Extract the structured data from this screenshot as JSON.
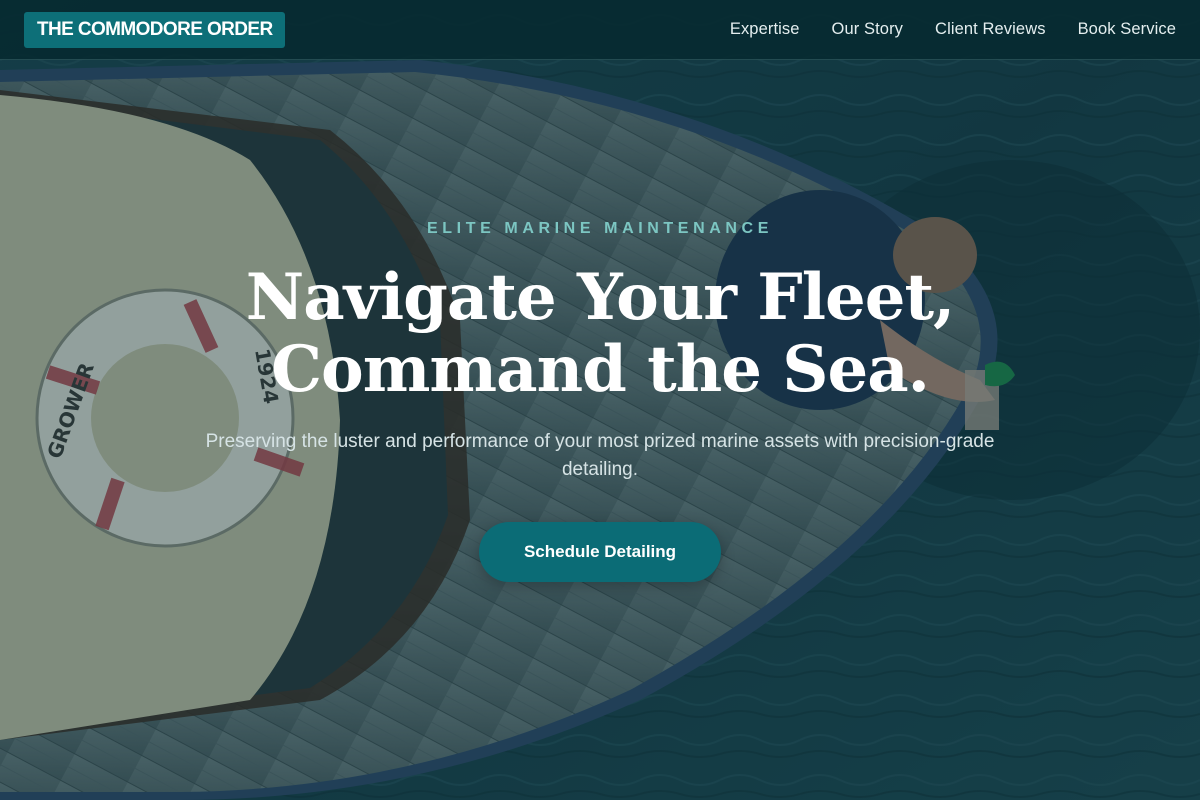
{
  "brand": {
    "name": "THE COMMODORE ORDER"
  },
  "nav": {
    "links": [
      {
        "label": "Expertise"
      },
      {
        "label": "Our Story"
      },
      {
        "label": "Client Reviews"
      },
      {
        "label": "Book Service"
      }
    ]
  },
  "hero": {
    "eyebrow": "ELITE MARINE MAINTENANCE",
    "headline_line1": "Navigate Your Fleet,",
    "headline_line2": "Command the Sea.",
    "subtitle": "Preserving the luster and performance of your most prized marine assets with precision-grade detailing.",
    "cta_label": "Schedule Detailing",
    "background": {
      "subject": "aerial view of wooden boat on dark water with life ring and person cleaning the bow",
      "life_ring_text": "GROWER 1924"
    }
  },
  "colors": {
    "accent": "#0d6f78",
    "eyebrow": "#7cc6c2",
    "nav_bg": "#062a31",
    "water": "#163c44"
  }
}
